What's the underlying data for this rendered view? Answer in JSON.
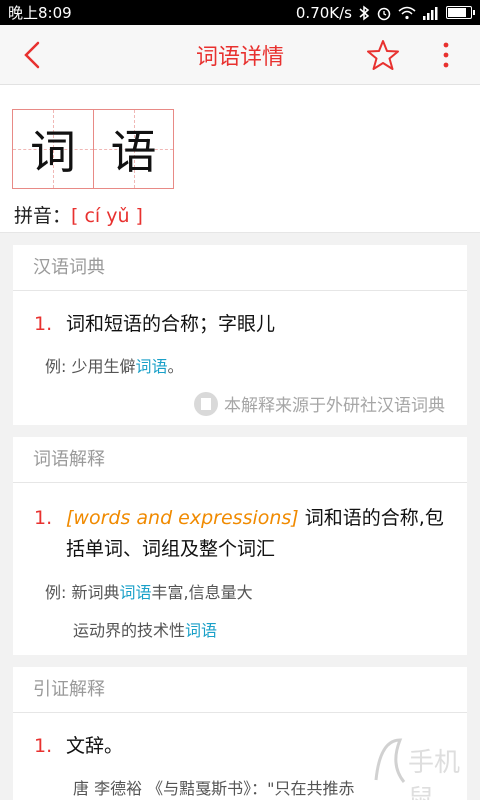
{
  "status_bar": {
    "time": "晚上8:09",
    "network_speed": "0.70K/s"
  },
  "app_bar": {
    "title": "词语详情"
  },
  "word": {
    "chars": [
      "词",
      "语"
    ],
    "pinyin_label": "拼音：",
    "pinyin": "[ cí yǔ ]"
  },
  "sections": {
    "hanyu": {
      "header": "汉语词典",
      "def_num": "1.",
      "def_text": "词和短语的合称；字眼儿",
      "example_prefix": "例: 少用生僻",
      "example_hl": "词语",
      "example_suffix": "。",
      "source": "本解释来源于外研社汉语词典"
    },
    "jieshi": {
      "header": "词语解释",
      "def_num": "1.",
      "def_en": "[words and expressions]",
      "def_line1": "词和语的合称,包",
      "def_line2": "括单词、词组及整个词汇",
      "ex1_prefix": "例: 新词典",
      "ex1_hl": "词语",
      "ex1_suffix": "丰富,信息量大",
      "ex2_prefix": "运动界的技术性",
      "ex2_hl": "词语"
    },
    "yinzheng": {
      "header": "引证解释",
      "def_num": "1.",
      "def_text": "文辞。",
      "quote": "唐 李德裕 《与黠戛斯书》：\"只在共推赤"
    }
  },
  "watermark": "手机鼠"
}
